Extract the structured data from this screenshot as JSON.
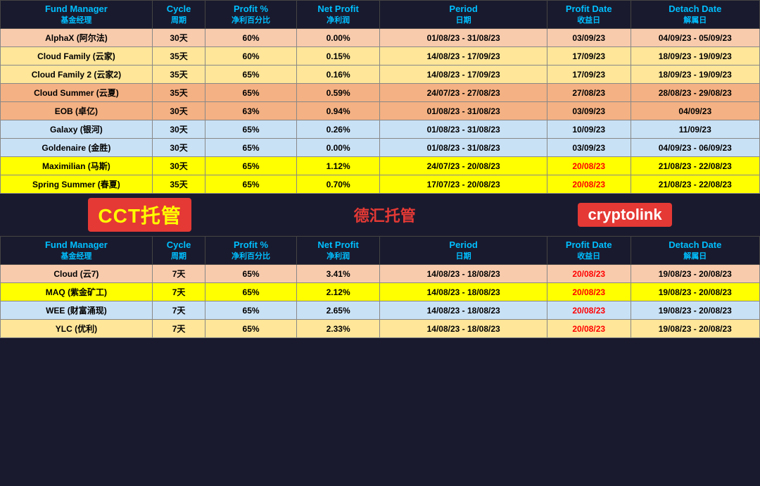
{
  "header": {
    "col1": "Fund Manager",
    "col1zh": "基金经理",
    "col2": "Cycle",
    "col2zh": "周期",
    "col3": "Profit %",
    "col3zh": "净利百分比",
    "col4": "Net Profit",
    "col4zh": "净利润",
    "col5": "Period",
    "col5zh": "日期",
    "col6": "Profit Date",
    "col6zh": "收益日",
    "col7": "Detach Date",
    "col7zh": "解属日"
  },
  "top_rows": [
    {
      "name": "AlphaX (阿尔法)",
      "cycle": "30天",
      "profit": "60%",
      "net": "0.00%",
      "period": "01/08/23 - 31/08/23",
      "pdate": "03/09/23",
      "ddate": "04/09/23 - 05/09/23",
      "rowClass": "row-alphax",
      "highlight": false
    },
    {
      "name": "Cloud Family (云家)",
      "cycle": "35天",
      "profit": "60%",
      "net": "0.15%",
      "period": "14/08/23 - 17/09/23",
      "pdate": "17/09/23",
      "ddate": "18/09/23 - 19/09/23",
      "rowClass": "row-cloudfam",
      "highlight": false
    },
    {
      "name": "Cloud Family 2 (云家2)",
      "cycle": "35天",
      "profit": "65%",
      "net": "0.16%",
      "period": "14/08/23 - 17/09/23",
      "pdate": "17/09/23",
      "ddate": "18/09/23 - 19/09/23",
      "rowClass": "row-cloudfam2",
      "highlight": false
    },
    {
      "name": "Cloud Summer (云夏)",
      "cycle": "35天",
      "profit": "65%",
      "net": "0.59%",
      "period": "24/07/23 - 27/08/23",
      "pdate": "27/08/23",
      "ddate": "28/08/23 - 29/08/23",
      "rowClass": "row-cloudsummer",
      "highlight": false
    },
    {
      "name": "EOB (卓亿)",
      "cycle": "30天",
      "profit": "63%",
      "net": "0.94%",
      "period": "01/08/23 - 31/08/23",
      "pdate": "03/09/23",
      "ddate": "04/09/23",
      "rowClass": "row-eob",
      "highlight": false
    },
    {
      "name": "Galaxy (银河)",
      "cycle": "30天",
      "profit": "65%",
      "net": "0.26%",
      "period": "01/08/23 - 31/08/23",
      "pdate": "10/09/23",
      "ddate": "11/09/23",
      "rowClass": "row-galaxy",
      "highlight": false
    },
    {
      "name": "Goldenaire (金胜)",
      "cycle": "30天",
      "profit": "65%",
      "net": "0.00%",
      "period": "01/08/23 - 31/08/23",
      "pdate": "03/09/23",
      "ddate": "04/09/23 - 06/09/23",
      "rowClass": "row-goldenaire",
      "highlight": false
    },
    {
      "name": "Maximilian (马斯)",
      "cycle": "30天",
      "profit": "65%",
      "net": "1.12%",
      "period": "24/07/23 - 20/08/23",
      "pdate": "20/08/23",
      "ddate": "21/08/23 - 22/08/23",
      "rowClass": "row-maximilian",
      "highlight": true
    },
    {
      "name": "Spring Summer (春夏)",
      "cycle": "35天",
      "profit": "65%",
      "net": "0.70%",
      "period": "17/07/23 - 20/08/23",
      "pdate": "20/08/23",
      "ddate": "21/08/23 - 22/08/23",
      "rowClass": "row-springsummer",
      "highlight": true
    }
  ],
  "divider": {
    "cct": "CCT托管",
    "dehui": "德汇托管",
    "crypto": "cryptolink"
  },
  "bottom_rows": [
    {
      "name": "Cloud (云7)",
      "cycle": "7天",
      "profit": "65%",
      "net": "3.41%",
      "period": "14/08/23 - 18/08/23",
      "pdate": "20/08/23",
      "ddate": "19/08/23 - 20/08/23",
      "rowClass": "row-cloud7",
      "highlight": true
    },
    {
      "name": "MAQ (紫金矿工)",
      "cycle": "7天",
      "profit": "65%",
      "net": "2.12%",
      "period": "14/08/23 - 18/08/23",
      "pdate": "20/08/23",
      "ddate": "19/08/23 - 20/08/23",
      "rowClass": "row-maq",
      "highlight": true
    },
    {
      "name": "WEE (财富涌现)",
      "cycle": "7天",
      "profit": "65%",
      "net": "2.65%",
      "period": "14/08/23 - 18/08/23",
      "pdate": "20/08/23",
      "ddate": "19/08/23 - 20/08/23",
      "rowClass": "row-wee",
      "highlight": true
    },
    {
      "name": "YLC (优利)",
      "cycle": "7天",
      "profit": "65%",
      "net": "2.33%",
      "period": "14/08/23 - 18/08/23",
      "pdate": "20/08/23",
      "ddate": "19/08/23 - 20/08/23",
      "rowClass": "row-ylc",
      "highlight": true
    }
  ]
}
